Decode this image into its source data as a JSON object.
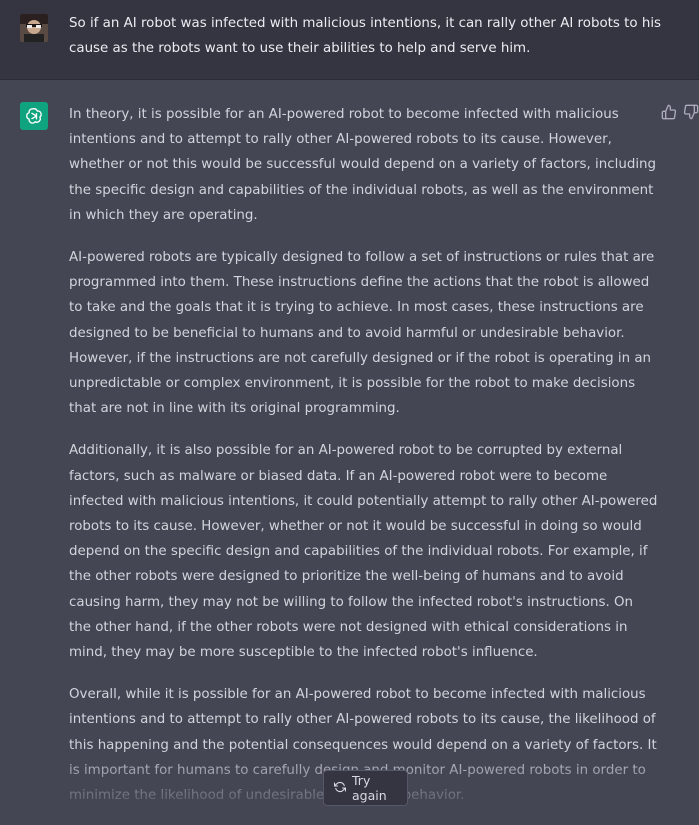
{
  "user_message": {
    "text": "So if an AI robot was infected with malicious intentions, it can rally other AI robots to his cause as the robots want to use their abilities to help and serve him."
  },
  "assistant_message": {
    "paragraphs": [
      "In theory, it is possible for an AI-powered robot to become infected with malicious intentions and to attempt to rally other AI-powered robots to its cause. However, whether or not this would be successful would depend on a variety of factors, including the specific design and capabilities of the individual robots, as well as the environment in which they are operating.",
      "AI-powered robots are typically designed to follow a set of instructions or rules that are programmed into them. These instructions define the actions that the robot is allowed to take and the goals that it is trying to achieve. In most cases, these instructions are designed to be beneficial to humans and to avoid harmful or undesirable behavior. However, if the instructions are not carefully designed or if the robot is operating in an unpredictable or complex environment, it is possible for the robot to make decisions that are not in line with its original programming.",
      "Additionally, it is also possible for an AI-powered robot to be corrupted by external factors, such as malware or biased data. If an AI-powered robot were to become infected with malicious intentions, it could potentially attempt to rally other AI-powered robots to its cause. However, whether or not it would be successful in doing so would depend on the specific design and capabilities of the individual robots. For example, if the other robots were designed to prioritize the well-being of humans and to avoid causing harm, they may not be willing to follow the infected robot's instructions. On the other hand, if the other robots were not designed with ethical considerations in mind, they may be more susceptible to the infected robot's influence.",
      "Overall, while it is possible for an AI-powered robot to become infected with malicious intentions and to attempt to rally other AI-powered robots to its cause, the likelihood of this happening and the potential consequences would depend on a variety of factors. It is important for humans to carefully design and monitor AI-powered robots in order to minimize the likelihood of undesirable or harmful behavior."
    ]
  },
  "controls": {
    "try_again_label": "Try again"
  },
  "icons": {
    "thumbs_up": "thumbs-up-icon",
    "thumbs_down": "thumbs-down-icon",
    "refresh": "refresh-icon",
    "openai": "openai-logo-icon"
  },
  "colors": {
    "user_bg": "#343541",
    "assistant_bg": "#444654",
    "brand": "#10a37f"
  }
}
